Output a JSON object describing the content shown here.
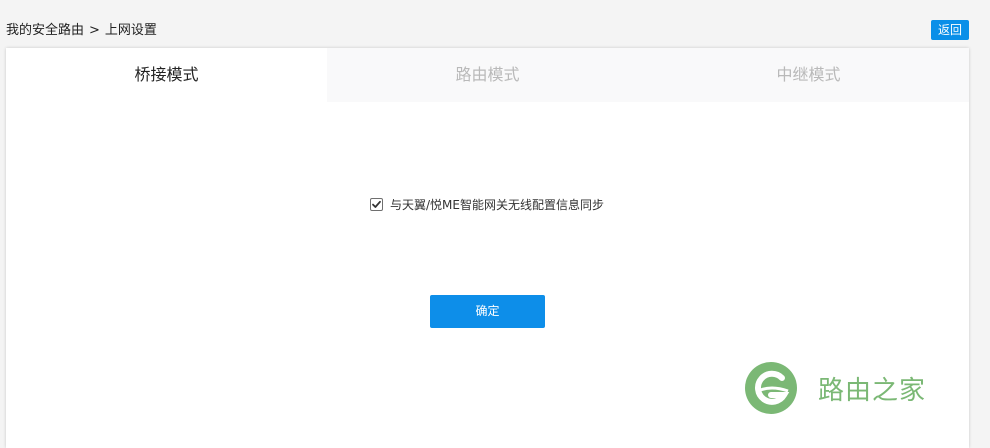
{
  "breadcrumb": {
    "root": "我的安全路由",
    "separator": ">",
    "current": "上网设置"
  },
  "header": {
    "back_label": "返回"
  },
  "tabs": [
    {
      "label": "桥接模式",
      "active": true
    },
    {
      "label": "路由模式",
      "active": false
    },
    {
      "label": "中继模式",
      "active": false
    }
  ],
  "form": {
    "sync_checked": true,
    "sync_label": "与天翼/悦ME智能网关无线配置信息同步",
    "confirm_label": "确定"
  },
  "watermark": {
    "text": "路由之家"
  },
  "colors": {
    "accent": "#0d8ee9",
    "inactive_tab_text": "#b9b9b9",
    "watermark_green": "#7bb875"
  }
}
